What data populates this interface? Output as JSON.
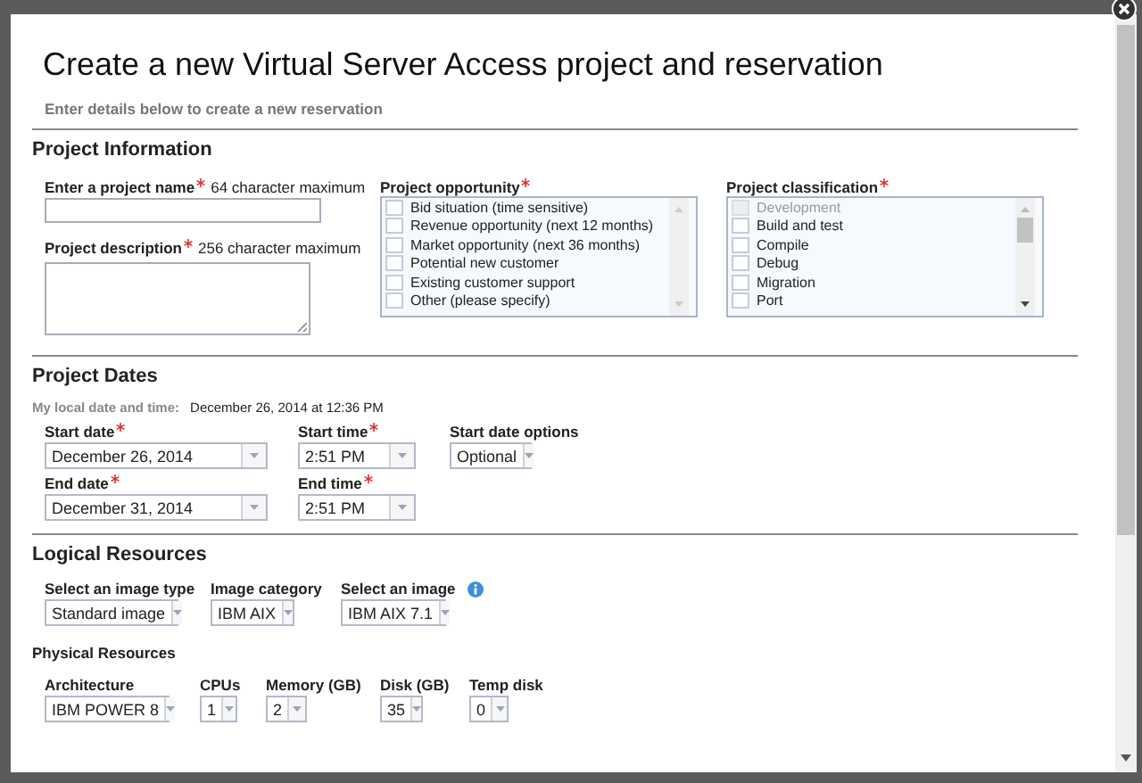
{
  "dialog": {
    "title": "Create a new Virtual Server Access project and reservation",
    "subtitle": "Enter details below to create a new reservation"
  },
  "project_information": {
    "heading": "Project Information",
    "project_name": {
      "label": "Enter a project name",
      "required": true,
      "hint": "64 character maximum"
    },
    "project_description": {
      "label": "Project description",
      "required": true,
      "hint": "256 character maximum"
    },
    "project_opportunity": {
      "label": "Project opportunity",
      "required": true,
      "options": [
        {
          "label": "Bid situation (time sensitive)",
          "checked": false,
          "disabled": false
        },
        {
          "label": "Revenue opportunity (next 12 months)",
          "checked": false,
          "disabled": false
        },
        {
          "label": "Market opportunity (next 36 months)",
          "checked": false,
          "disabled": false
        },
        {
          "label": "Potential new customer",
          "checked": false,
          "disabled": false
        },
        {
          "label": "Existing customer support",
          "checked": false,
          "disabled": false
        },
        {
          "label": "Other (please specify)",
          "checked": false,
          "disabled": false
        }
      ]
    },
    "project_classification": {
      "label": "Project classification",
      "required": true,
      "options": [
        {
          "label": "Development",
          "checked": false,
          "disabled": true
        },
        {
          "label": "Build and test",
          "checked": false,
          "disabled": false
        },
        {
          "label": "Compile",
          "checked": false,
          "disabled": false
        },
        {
          "label": "Debug",
          "checked": false,
          "disabled": false
        },
        {
          "label": "Migration",
          "checked": false,
          "disabled": false
        },
        {
          "label": "Port",
          "checked": false,
          "disabled": false
        }
      ]
    }
  },
  "project_dates": {
    "heading": "Project Dates",
    "local_time_label": "My local date and time:",
    "local_time": "December 26, 2014 at 12:36 PM",
    "fields": [
      {
        "label": "Start date",
        "required": true,
        "value": "December 26, 2014"
      },
      {
        "label": "Start time",
        "required": true,
        "value": "2:51 PM"
      },
      {
        "label": "Start date options",
        "required": false,
        "value": "Optional"
      },
      {
        "label": "End date",
        "required": true,
        "value": "December 31, 2014"
      },
      {
        "label": "End time",
        "required": true,
        "value": "2:51 PM"
      }
    ]
  },
  "logical_resources": {
    "heading": "Logical Resources",
    "fields": [
      {
        "label": "Select an image type",
        "value": "Standard image",
        "info": false
      },
      {
        "label": "Image category",
        "value": "IBM AIX",
        "info": false
      },
      {
        "label": "Select an image",
        "value": "IBM AIX 7.1",
        "info": true
      }
    ]
  },
  "physical_resources": {
    "heading": "Physical Resources",
    "fields": [
      {
        "label": "Architecture",
        "value": "IBM POWER 8"
      },
      {
        "label": "CPUs",
        "value": "1"
      },
      {
        "label": "Memory (GB)",
        "value": "2"
      },
      {
        "label": "Disk (GB)",
        "value": "35"
      },
      {
        "label": "Temp disk",
        "value": "0"
      }
    ]
  }
}
